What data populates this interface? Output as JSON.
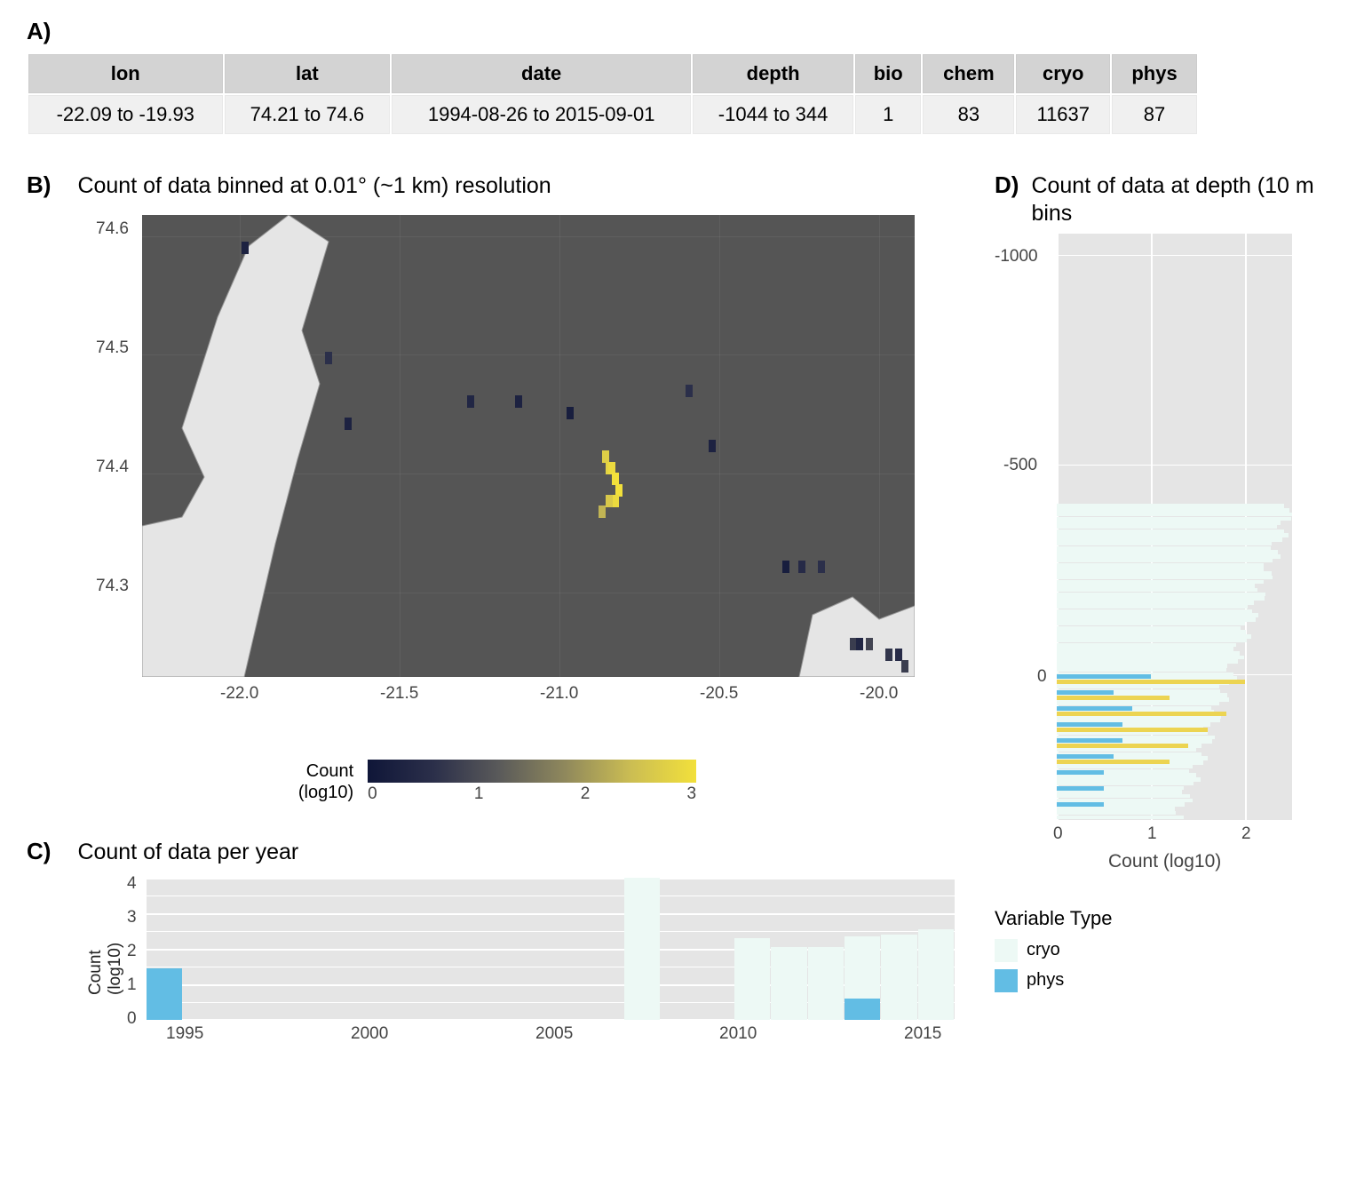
{
  "panelA": {
    "label": "A)",
    "headers": [
      "lon",
      "lat",
      "date",
      "depth",
      "bio",
      "chem",
      "cryo",
      "phys"
    ],
    "row": [
      "-22.09 to -19.93",
      "74.21 to 74.6",
      "1994-08-26 to 2015-09-01",
      "-1044 to 344",
      "1",
      "83",
      "11637",
      "87"
    ]
  },
  "panelB": {
    "label": "B)",
    "title": "Count of data binned at 0.01° (~1 km) resolution",
    "xticks": [
      "-22.0",
      "-21.5",
      "-21.0",
      "-20.5",
      "-20.0"
    ],
    "yticks": [
      "74.3",
      "74.4",
      "74.5",
      "74.6"
    ],
    "colorbar": {
      "title_l1": "Count",
      "title_l2": "(log10)",
      "ticks": [
        "0",
        "1",
        "2",
        "3"
      ]
    }
  },
  "panelC": {
    "label": "C)",
    "title": "Count of data per year",
    "ylabel": "Count\n(log10)",
    "yticks": [
      "0",
      "1",
      "2",
      "3",
      "4"
    ],
    "xticks": [
      "1995",
      "2000",
      "2005",
      "2010",
      "2015"
    ]
  },
  "panelD": {
    "label": "D)",
    "title": "Count of data at depth (10 m bins",
    "yticks": [
      "0",
      "-500",
      "-1000"
    ],
    "xticks": [
      "0",
      "1",
      "2"
    ],
    "xlabel": "Count (log10)"
  },
  "legend": {
    "title": "Variable Type",
    "items": [
      {
        "name": "cryo",
        "color": "#edf9f5"
      },
      {
        "name": "phys",
        "color": "#62bde4"
      }
    ]
  },
  "chart_data": [
    {
      "id": "A",
      "type": "table",
      "columns": [
        "lon",
        "lat",
        "date",
        "depth",
        "bio",
        "chem",
        "cryo",
        "phys"
      ],
      "rows": [
        [
          "-22.09 to -19.93",
          "74.21 to 74.6",
          "1994-08-26 to 2015-09-01",
          "-1044 to 344",
          1,
          83,
          11637,
          87
        ]
      ]
    },
    {
      "id": "B",
      "type": "heatmap",
      "title": "Count of data binned at 0.01° (~1 km) resolution",
      "xlabel": "lon",
      "ylabel": "lat",
      "xlim": [
        -22.3,
        -19.9
      ],
      "ylim": [
        74.21,
        74.63
      ],
      "color_scale": "log10",
      "clim": [
        0,
        3
      ],
      "points": [
        {
          "lon": -21.98,
          "lat": 74.6,
          "log10": 0.3
        },
        {
          "lon": -21.72,
          "lat": 74.5,
          "log10": 0.6
        },
        {
          "lon": -21.66,
          "lat": 74.44,
          "log10": 0.3
        },
        {
          "lon": -21.28,
          "lat": 74.46,
          "log10": 0.4
        },
        {
          "lon": -21.13,
          "lat": 74.46,
          "log10": 0.3
        },
        {
          "lon": -20.97,
          "lat": 74.45,
          "log10": 0.2
        },
        {
          "lon": -20.6,
          "lat": 74.47,
          "log10": 0.6
        },
        {
          "lon": -20.53,
          "lat": 74.42,
          "log10": 0.3
        },
        {
          "lon": -20.86,
          "lat": 74.41,
          "log10": 2.7
        },
        {
          "lon": -20.85,
          "lat": 74.4,
          "log10": 2.8
        },
        {
          "lon": -20.84,
          "lat": 74.4,
          "log10": 2.9
        },
        {
          "lon": -20.83,
          "lat": 74.39,
          "log10": 3.0
        },
        {
          "lon": -20.82,
          "lat": 74.38,
          "log10": 3.0
        },
        {
          "lon": -20.83,
          "lat": 74.37,
          "log10": 2.9
        },
        {
          "lon": -20.85,
          "lat": 74.37,
          "log10": 2.6
        },
        {
          "lon": -20.87,
          "lat": 74.36,
          "log10": 2.3
        },
        {
          "lon": -20.3,
          "lat": 74.31,
          "log10": 0.2
        },
        {
          "lon": -20.25,
          "lat": 74.31,
          "log10": 0.5
        },
        {
          "lon": -20.19,
          "lat": 74.31,
          "log10": 0.6
        },
        {
          "lon": -20.09,
          "lat": 74.24,
          "log10": 0.8
        },
        {
          "lon": -20.07,
          "lat": 74.24,
          "log10": 0.4
        },
        {
          "lon": -20.04,
          "lat": 74.24,
          "log10": 0.9
        },
        {
          "lon": -19.98,
          "lat": 74.23,
          "log10": 0.7
        },
        {
          "lon": -19.95,
          "lat": 74.23,
          "log10": 0.5
        },
        {
          "lon": -19.93,
          "lat": 74.22,
          "log10": 0.8
        }
      ]
    },
    {
      "id": "C",
      "type": "bar",
      "title": "Count of data per year",
      "xlabel": "year",
      "ylabel": "Count (log10)",
      "ylim": [
        0,
        4
      ],
      "categories": [
        1994,
        1995,
        1996,
        1997,
        1998,
        1999,
        2000,
        2001,
        2002,
        2003,
        2004,
        2005,
        2006,
        2007,
        2008,
        2009,
        2010,
        2011,
        2012,
        2013,
        2014,
        2015
      ],
      "series": [
        {
          "name": "cryo",
          "values": [
            0,
            0,
            0,
            0,
            0,
            0,
            0,
            0,
            0,
            0,
            0,
            0,
            0,
            4.05,
            0,
            0,
            2.3,
            2.05,
            2.05,
            2.35,
            2.4,
            2.55
          ]
        },
        {
          "name": "phys",
          "values": [
            1.45,
            0,
            0,
            0,
            0,
            0,
            0,
            0,
            0,
            0,
            0,
            0,
            0,
            0,
            0,
            0,
            0,
            0,
            0,
            0.6,
            0,
            0
          ]
        }
      ]
    },
    {
      "id": "D",
      "type": "bar",
      "title": "Count of data at depth (10 m bins",
      "orientation": "horizontal",
      "xlabel": "Count (log10)",
      "ylabel": "depth",
      "xlim": [
        0,
        2.5
      ],
      "ylim": [
        -1050,
        344
      ],
      "series": [
        {
          "name": "cryo",
          "note": "dense bars from depth ~ -1044 to ~ -300, counts log10 roughly 1.3 to 2.5 increasing toward shallower depths"
        },
        {
          "name": "phys",
          "depths": [
            -10,
            -50,
            -80,
            -100,
            -120,
            -150,
            -200,
            -300,
            -340
          ],
          "log10": [
            1.0,
            0.6,
            0.8,
            0.7,
            0.7,
            0.6,
            0.5,
            0.5,
            0.5
          ]
        },
        {
          "name": "chem",
          "depths": [
            -10,
            -50,
            -100,
            -120,
            -150,
            -200
          ],
          "log10": [
            2.0,
            1.2,
            1.8,
            1.6,
            1.4,
            1.2
          ]
        }
      ]
    }
  ]
}
